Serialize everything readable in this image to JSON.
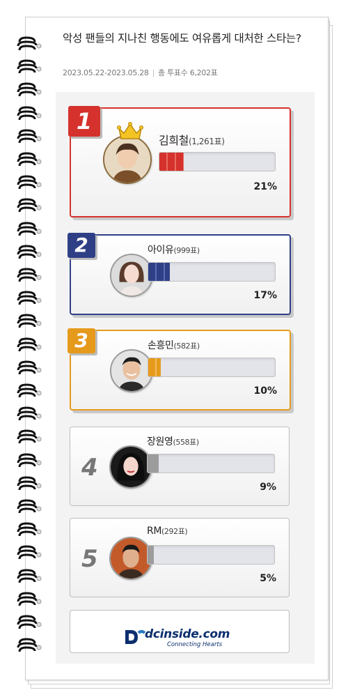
{
  "poll": {
    "title": "악성 팬들의 지나친 행동에도 여유롭게 대처한 스타는?",
    "period": "2023.05.22-2023.05.28",
    "total_label": "총 투표수 6,202표"
  },
  "ranking": [
    {
      "rank": "1",
      "name": "김희철",
      "votes": "(1,261표)",
      "percent": "21%",
      "share": 21,
      "color": "#d5322d"
    },
    {
      "rank": "2",
      "name": "아이유",
      "votes": "(999표)",
      "percent": "17%",
      "share": 17,
      "color": "#2f3f86"
    },
    {
      "rank": "3",
      "name": "손흥민",
      "votes": "(582표)",
      "percent": "10%",
      "share": 10,
      "color": "#e69a1c"
    },
    {
      "rank": "4",
      "name": "장원영",
      "votes": "(558표)",
      "percent": "9%",
      "share": 9,
      "color": "#9c9c9c"
    },
    {
      "rank": "5",
      "name": "RM",
      "votes": "(292표)",
      "percent": "5%",
      "share": 5,
      "color": "#9c9c9c"
    }
  ],
  "footer": {
    "logo_text": "dcinside.com",
    "logo_tagline": "Connecting Hearts"
  },
  "icons": {
    "crown": "crown-icon",
    "logo": "dcinside-logo-icon",
    "spiral": "spiral-binding-icon"
  }
}
